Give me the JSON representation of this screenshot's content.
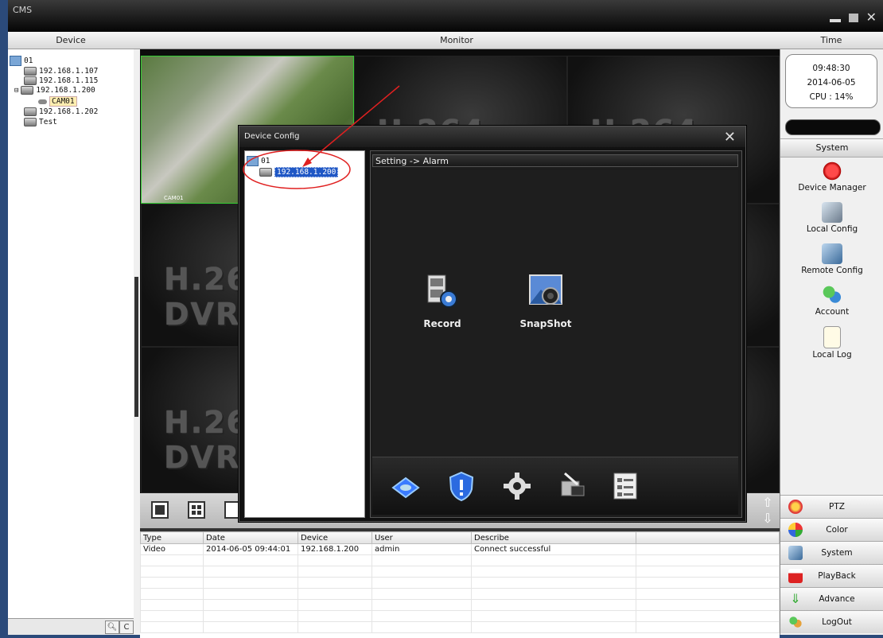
{
  "window": {
    "title": "CMS"
  },
  "headers": {
    "device": "Device",
    "monitor": "Monitor",
    "time": "Time"
  },
  "device_tree": [
    {
      "label": "01",
      "type": "group"
    },
    {
      "label": "192.168.1.107",
      "type": "dvr"
    },
    {
      "label": "192.168.1.115",
      "type": "dvr"
    },
    {
      "label": "192.168.1.200",
      "type": "dvr",
      "expanded": true
    },
    {
      "label": "CAM01",
      "type": "camera",
      "selected": true
    },
    {
      "label": "192.168.1.202",
      "type": "dvr"
    },
    {
      "label": "Test",
      "type": "dvr"
    }
  ],
  "monitor": {
    "cam_label": "CAM01",
    "placeholder_logo": "H.264 DVR"
  },
  "log": {
    "columns": [
      "Type",
      "Date",
      "Device",
      "User",
      "Describe"
    ],
    "rows": [
      [
        "Video",
        "2014-06-05 09:44:01",
        "192.168.1.200",
        "admin",
        "Connect successful"
      ]
    ]
  },
  "status": {
    "time": "09:48:30",
    "date": "2014-06-05",
    "cpu": "CPU : 14%"
  },
  "system": {
    "header": "System",
    "items": [
      "Device Manager",
      "Local Config",
      "Remote Config",
      "Account",
      "Local Log"
    ]
  },
  "bottom_buttons": [
    "PTZ",
    "Color",
    "System",
    "PlayBack",
    "Advance",
    "LogOut"
  ],
  "dialog": {
    "title": "Device Config",
    "tree_root": "01",
    "tree_device": "192.168.1.200",
    "breadcrumb": "Setting -> Alarm",
    "icons": [
      "Record",
      "SnapShot"
    ]
  },
  "colors": {
    "accent_red": "#e02020",
    "selection": "#1f57c5",
    "dock_blue": "#3a7bff"
  }
}
